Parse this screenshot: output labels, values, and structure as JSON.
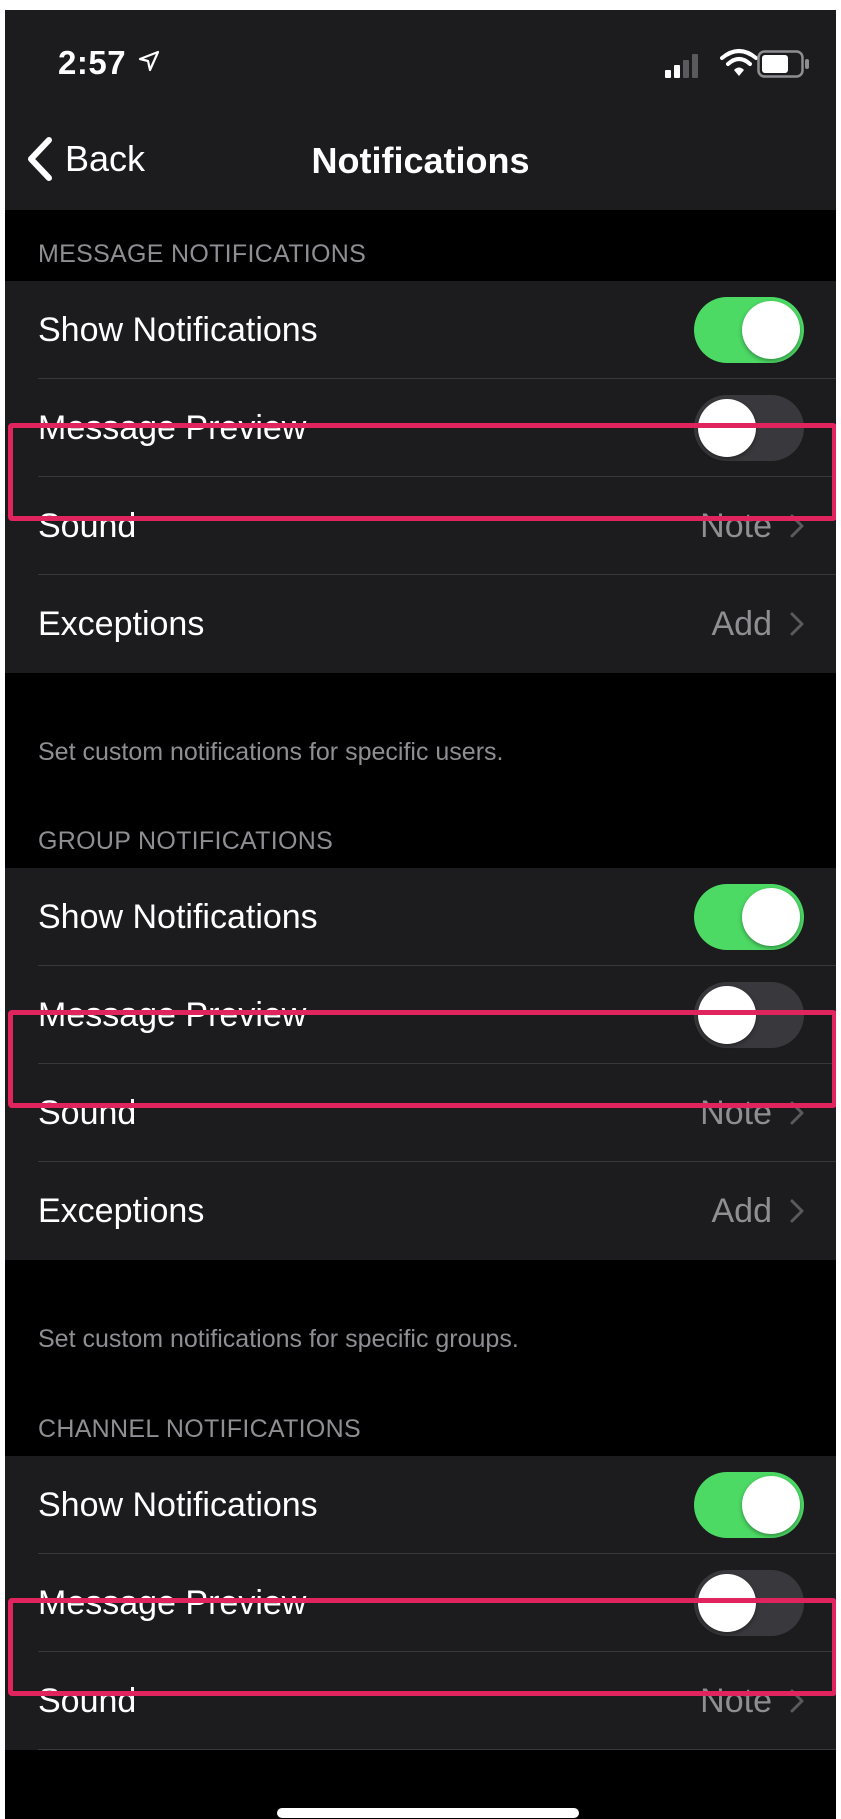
{
  "status_bar": {
    "time": "2:57",
    "icons": [
      "location-arrow-icon",
      "cellular-signal-icon",
      "wifi-icon",
      "battery-icon"
    ]
  },
  "nav": {
    "back_label": "Back",
    "title": "Notifications"
  },
  "colors": {
    "background": "#000000",
    "cell_background": "#1c1c1e",
    "toggle_on": "#4cd964",
    "toggle_off": "#39393d",
    "secondary_text": "#8e8e93",
    "highlight_border": "#e0245e"
  },
  "sections": [
    {
      "header": "MESSAGE NOTIFICATIONS",
      "show_notifications": {
        "label": "Show Notifications",
        "on": true
      },
      "message_preview": {
        "label": "Message Preview",
        "on": false,
        "highlighted": true
      },
      "sound": {
        "label": "Sound",
        "value": "Note"
      },
      "exceptions": {
        "label": "Exceptions",
        "value": "Add"
      },
      "footer": "Set custom notifications for specific users."
    },
    {
      "header": "GROUP NOTIFICATIONS",
      "show_notifications": {
        "label": "Show Notifications",
        "on": true
      },
      "message_preview": {
        "label": "Message Preview",
        "on": false,
        "highlighted": true
      },
      "sound": {
        "label": "Sound",
        "value": "Note"
      },
      "exceptions": {
        "label": "Exceptions",
        "value": "Add"
      },
      "footer": "Set custom notifications for specific groups."
    },
    {
      "header": "CHANNEL NOTIFICATIONS",
      "show_notifications": {
        "label": "Show Notifications",
        "on": true
      },
      "message_preview": {
        "label": "Message Preview",
        "on": false,
        "highlighted": true
      },
      "sound": {
        "label": "Sound",
        "value": "Note"
      }
    }
  ]
}
